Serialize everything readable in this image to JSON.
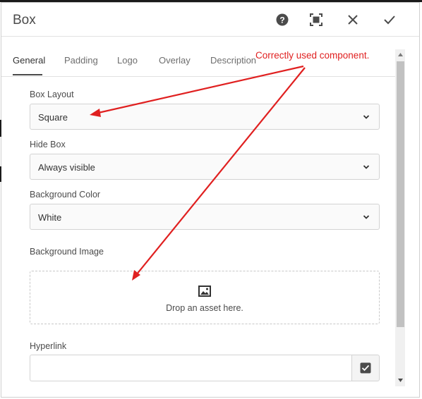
{
  "dialog": {
    "title": "Box",
    "header_icons": [
      "help-icon",
      "fullscreen-icon",
      "close-icon",
      "check-icon"
    ]
  },
  "tabs": [
    {
      "label": "General",
      "active": true
    },
    {
      "label": "Padding",
      "active": false
    },
    {
      "label": "Logo",
      "active": false
    },
    {
      "label": "Overlay",
      "active": false
    },
    {
      "label": "Description",
      "active": false
    }
  ],
  "fields": {
    "box_layout": {
      "label": "Box Layout",
      "value": "Square"
    },
    "hide_box": {
      "label": "Hide Box",
      "value": "Always visible"
    },
    "background_color": {
      "label": "Background Color",
      "value": "White"
    },
    "background_image": {
      "label": "Background Image",
      "dropzone_text": "Drop an asset here."
    },
    "hyperlink": {
      "label": "Hyperlink",
      "value": ""
    }
  },
  "annotation": {
    "text": "Correctly used component.",
    "color": "#e02020"
  }
}
